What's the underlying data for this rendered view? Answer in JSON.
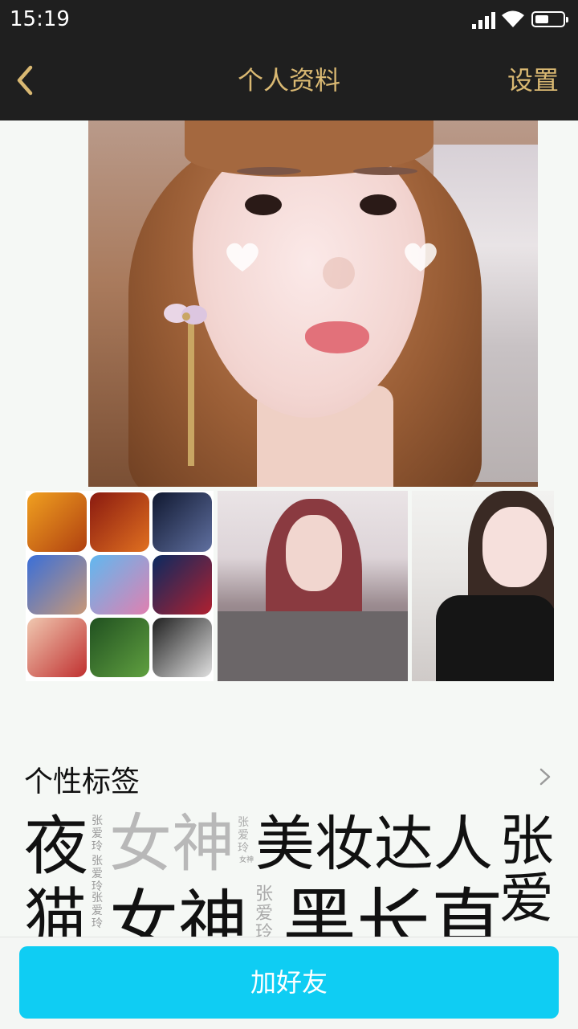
{
  "status_bar": {
    "time": "15:19"
  },
  "nav": {
    "title": "个人资料",
    "settings_label": "设置"
  },
  "tags_section": {
    "title": "个性标签",
    "tags_row1": [
      {
        "text": "夜",
        "color": "#111111"
      },
      {
        "text": "女神",
        "color": "#b8b8b8"
      },
      {
        "text": "美妆达人",
        "color": "#111111"
      },
      {
        "text": "张",
        "color": "#111111"
      }
    ],
    "tags_row2": [
      {
        "text": "猫",
        "color": "#111111"
      },
      {
        "text": "女神",
        "color": "#111111"
      },
      {
        "text": "黑长直",
        "color": "#111111"
      },
      {
        "text": "爱",
        "color": "#111111"
      }
    ],
    "small_tag": "张爱玲",
    "tiny_tag": "女神"
  },
  "bottom": {
    "add_friend_label": "加好友"
  },
  "colors": {
    "accent": "#d9b872",
    "nav_bg": "#1f1f1f",
    "button": "#0fcdf3"
  },
  "icons": [
    "back-arrow-icon",
    "signal-icon",
    "wifi-icon",
    "battery-icon",
    "chevron-right-icon"
  ]
}
